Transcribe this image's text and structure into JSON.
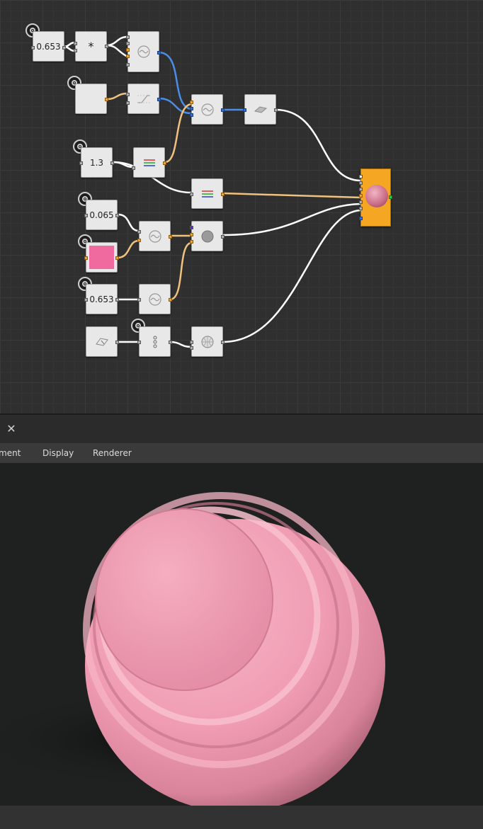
{
  "graph": {
    "nodes": {
      "value_top": "0.653",
      "multiply": "*",
      "value_mid": "1.3",
      "value_small": "0.065",
      "value_bottom": "0.653"
    },
    "colors": {
      "swatch": "#f06aa0",
      "output_node": "#f5a623",
      "wire_blue": "#4a8ee8",
      "wire_orange": "#f1c27d",
      "wire_white": "#ffffff"
    },
    "icons": [
      "knob-icon",
      "noise-icon",
      "ramp-icon",
      "plane-icon",
      "levels-icon",
      "sphere-icon",
      "plane-pick-icon",
      "vector-icon",
      "globe-icon",
      "material-preview-icon"
    ]
  },
  "panel": {
    "close_label": "✕",
    "menu": [
      "ment",
      "Display",
      "Renderer"
    ]
  },
  "viewport": {
    "object_color": "#f4a0b6"
  }
}
